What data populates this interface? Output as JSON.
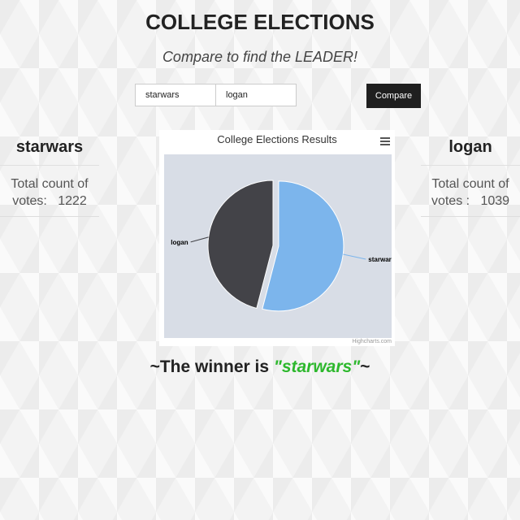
{
  "header": {
    "title": "COLLEGE ELECTIONS",
    "subtitle": "Compare to find the LEADER!"
  },
  "form": {
    "input1_value": "starwars",
    "input2_value": "logan",
    "button_label": "Compare"
  },
  "left": {
    "name": "starwars",
    "count_label": "Total count of votes:",
    "count": "1222"
  },
  "right": {
    "name": "logan",
    "count_label": "Total count of votes :",
    "count": "1039"
  },
  "chart": {
    "credits": "Highcharts.com",
    "plot_bg": "#d8dde6"
  },
  "chart_data": {
    "type": "pie",
    "title": "College Elections Results",
    "slices": [
      {
        "label": "starwars",
        "value": 1222,
        "color": "#7cb5ec"
      },
      {
        "label": "logan",
        "value": 1039,
        "color": "#434348"
      }
    ]
  },
  "result": {
    "prefix": "~The winner is ",
    "winner": "\"starwars\"",
    "suffix": "~"
  }
}
